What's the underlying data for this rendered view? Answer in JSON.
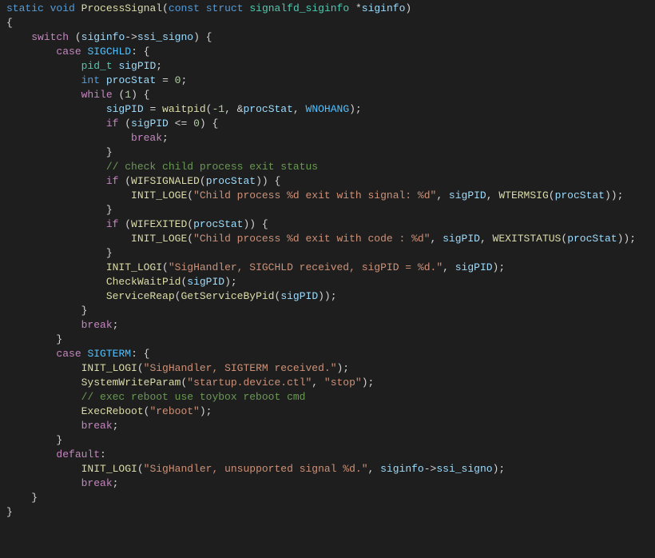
{
  "tokens": {
    "static": "static",
    "void": "void",
    "const": "const",
    "struct": "struct",
    "int": "int",
    "switch": "switch",
    "case": "case",
    "while": "while",
    "if": "if",
    "break": "break",
    "default": "default",
    "pid_t": "pid_t",
    "signalfd_siginfo": "signalfd_siginfo",
    "ProcessSignal": "ProcessSignal",
    "siginfo": "siginfo",
    "ssi_signo": "ssi_signo",
    "SIGCHLD": "SIGCHLD",
    "SIGTERM": "SIGTERM",
    "sigPID": "sigPID",
    "procStat": "procStat",
    "waitpid": "waitpid",
    "WNOHANG": "WNOHANG",
    "WIFSIGNALED": "WIFSIGNALED",
    "WTERMSIG": "WTERMSIG",
    "WIFEXITED": "WIFEXITED",
    "WEXITSTATUS": "WEXITSTATUS",
    "INIT_LOGE": "INIT_LOGE",
    "INIT_LOGI": "INIT_LOGI",
    "CheckWaitPid": "CheckWaitPid",
    "ServiceReap": "ServiceReap",
    "GetServiceByPid": "GetServiceByPid",
    "SystemWriteParam": "SystemWriteParam",
    "ExecReboot": "ExecReboot"
  },
  "strings": {
    "child_signal": "\"Child process %d exit with signal: %d\"",
    "child_code": "\"Child process %d exit with code : %d\"",
    "sigchld_recv": "\"SigHandler, SIGCHLD received, sigPID = %d.\"",
    "sigterm_recv": "\"SigHandler, SIGTERM received.\"",
    "startup_key": "\"startup.device.ctl\"",
    "stop": "\"stop\"",
    "reboot": "\"reboot\"",
    "unsupported": "\"SigHandler, unsupported signal %d.\""
  },
  "comments": {
    "check_child": "// check child process exit status",
    "exec_reboot": "// exec reboot use toybox reboot cmd"
  },
  "numbers": {
    "zero": "0",
    "one": "1",
    "neg1": "-1"
  }
}
